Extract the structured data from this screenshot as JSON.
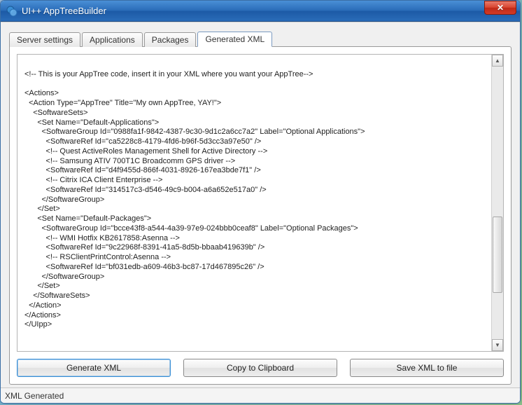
{
  "window": {
    "title": "UI++ AppTreeBuilder",
    "close_glyph": "✕"
  },
  "tabs": {
    "items": [
      {
        "label": "Server settings",
        "active": false
      },
      {
        "label": "Applications",
        "active": false
      },
      {
        "label": "Packages",
        "active": false
      },
      {
        "label": "Generated XML",
        "active": true
      }
    ]
  },
  "xml": {
    "text": "\n<!-- This is your AppTree code, insert it in your XML where you want your AppTree-->\n\n<Actions>\n  <Action Type=\"AppTree\" Title=\"My own AppTree, YAY!\">\n    <SoftwareSets>\n      <Set Name=\"Default-Applications\">\n        <SoftwareGroup Id=\"0988fa1f-9842-4387-9c30-9d1c2a6cc7a2\" Label=\"Optional Applications\">\n          <SoftwareRef Id=\"ca5228c8-4179-4fd6-b96f-5d3cc3a97e50\" />\n          <!-- Quest ActiveRoles Management Shell for Active Directory -->\n          <!-- Samsung ATIV 700T1C Broadcomm GPS driver -->\n          <SoftwareRef Id=\"d4f9455d-866f-4031-8926-167ea3bde7f1\" />\n          <!-- Citrix ICA Client Enterprise -->\n          <SoftwareRef Id=\"314517c3-d546-49c9-b004-a6a652e517a0\" />\n        </SoftwareGroup>\n      </Set>\n      <Set Name=\"Default-Packages\">\n        <SoftwareGroup Id=\"bcce43f8-a544-4a39-97e9-024bbb0ceaf8\" Label=\"Optional Packages\">\n          <!-- WMI Hotfix KB2617858:Asenna -->\n          <SoftwareRef Id=\"9c22968f-8391-41a5-8d5b-bbaab419639b\" />\n          <!-- RSClientPrintControl:Asenna -->\n          <SoftwareRef Id=\"bf031edb-a609-46b3-bc87-17d467895c26\" />\n        </SoftwareGroup>\n      </Set>\n    </SoftwareSets>\n  </Action>\n</Actions>\n</UIpp>"
  },
  "buttons": {
    "generate": "Generate XML",
    "copy": "Copy to Clipboard",
    "save": "Save XML to file"
  },
  "status": {
    "text": "XML Generated"
  }
}
